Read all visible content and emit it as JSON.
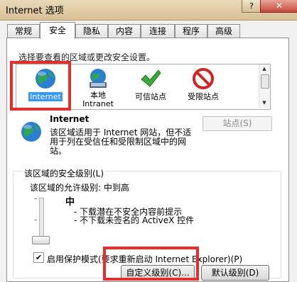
{
  "window": {
    "title": "Internet 选项",
    "help": "?",
    "close": "✕"
  },
  "tabs": [
    {
      "label": "常规"
    },
    {
      "label": "安全"
    },
    {
      "label": "隐私"
    },
    {
      "label": "内容"
    },
    {
      "label": "连接"
    },
    {
      "label": "程序"
    },
    {
      "label": "高级"
    }
  ],
  "zones": {
    "hint": "选择要查看的区域或更改安全设置。",
    "items": [
      {
        "label": "Internet",
        "label2": "",
        "icon": "globe-icon",
        "selected": true
      },
      {
        "label": "本地",
        "label2": "Intranet",
        "icon": "local-intranet-icon"
      },
      {
        "label": "可信站点",
        "label2": "",
        "icon": "checkmark-icon"
      },
      {
        "label": "受限站点",
        "label2": "",
        "icon": "restricted-icon"
      }
    ]
  },
  "zone_info": {
    "title": "Internet",
    "description": "该区域适用于 Internet 网站，但不适用于列在受信任和受限制区域中的网站。",
    "sites_button": "站点(S)"
  },
  "security_level": {
    "group_title": "该区域的安全级别(L)",
    "allowed_label": "该区域的允许级别: 中到高",
    "level_name": "中",
    "bullets": [
      "- 下载潜在不安全内容前提示",
      "- 不下载未签名的 ActiveX 控件"
    ],
    "slider_level": "中"
  },
  "protected_mode": {
    "label": "启用保护模式(要求重新启动 Internet Explorer)(P)",
    "checked": true
  },
  "buttons": {
    "custom": "自定义级别(C)...",
    "default": "默认级别(D)"
  },
  "colors": {
    "highlight_box": "#ec2a2a",
    "selection": "#3399ff"
  }
}
